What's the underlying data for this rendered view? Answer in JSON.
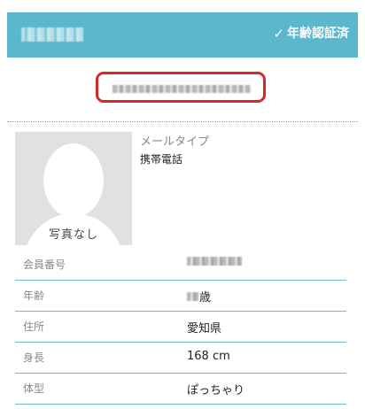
{
  "header": {
    "name_redacted": "",
    "verified_label": "年齢認証済",
    "check_icon": "checkmark-icon"
  },
  "profile_id": {
    "redacted": ""
  },
  "avatar": {
    "caption": "写真なし",
    "icon": "person-silhouette-icon"
  },
  "mail": {
    "label": "メールタイプ",
    "value": "携帯電話"
  },
  "info": {
    "rows": [
      {
        "key": "会員番号",
        "value": ""
      },
      {
        "key": "年齢",
        "suffix": "歳"
      },
      {
        "key": "住所",
        "value": "愛知県"
      },
      {
        "key": "身長",
        "value": "168 cm"
      },
      {
        "key": "体型",
        "value": "ぽっちゃり"
      }
    ]
  },
  "colors": {
    "header_bg": "#5ab7cc",
    "highlight_border": "#d62828",
    "row_divider": "#6fb9c9"
  }
}
